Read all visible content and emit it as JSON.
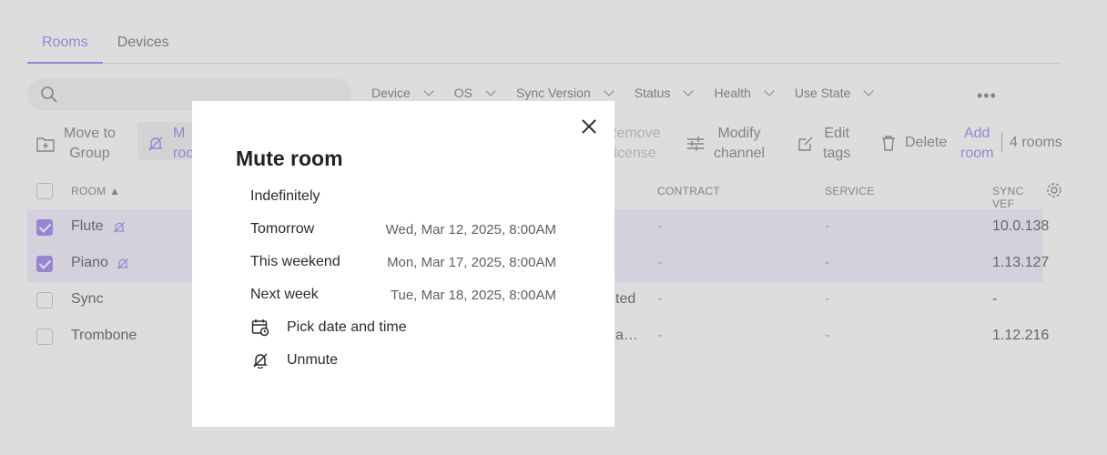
{
  "tabs": [
    "Rooms",
    "Devices"
  ],
  "filters": [
    "Device",
    "OS",
    "Sync Version",
    "Status",
    "Health",
    "Use State"
  ],
  "toolbar": {
    "move_to_group": [
      "Move to",
      "Group"
    ],
    "mute_room": [
      "M",
      "roo"
    ],
    "remove_license": [
      "Remove",
      "license"
    ],
    "modify_channel": [
      "Modify",
      "channel"
    ],
    "edit_tags": [
      "Edit",
      "tags"
    ],
    "delete": "Delete",
    "add_room": [
      "Add",
      "room"
    ],
    "room_count": "4 rooms"
  },
  "table": {
    "headers": {
      "room": "ROOM",
      "contract": "CONTRACT",
      "service": "SERVICE",
      "sync_version": "SYNC VEF"
    },
    "rows": [
      {
        "name": "Flute",
        "selected": true,
        "muted": true,
        "mid": "",
        "contract": "-",
        "service": "-",
        "sync": "10.0.138"
      },
      {
        "name": "Piano",
        "selected": true,
        "muted": true,
        "mid": "",
        "contract": "-",
        "service": "-",
        "sync": "1.13.127"
      },
      {
        "name": "Sync",
        "selected": false,
        "muted": false,
        "mid": "ted",
        "contract": "-",
        "service": "-",
        "sync": "-"
      },
      {
        "name": "Trombone",
        "selected": false,
        "muted": false,
        "mid": "a…",
        "contract": "-",
        "service": "-",
        "sync": "1.12.216"
      }
    ]
  },
  "modal": {
    "title": "Mute room",
    "options": [
      {
        "label": "Indefinitely",
        "when": ""
      },
      {
        "label": "Tomorrow",
        "when": "Wed, Mar 12, 2025, 8:00AM"
      },
      {
        "label": "This weekend",
        "when": "Mon, Mar 17, 2025, 8:00AM"
      },
      {
        "label": "Next week",
        "when": "Tue, Mar 18, 2025, 8:00AM"
      }
    ],
    "pick_date": "Pick date and time",
    "unmute": "Unmute"
  },
  "colors": {
    "accent": "#8b6cf2",
    "selected_row": "#f1ecff"
  }
}
